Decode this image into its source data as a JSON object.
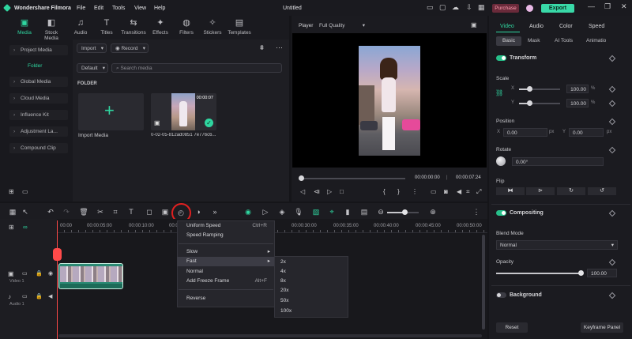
{
  "app": {
    "title": "Wondershare Filmora",
    "project_name": "Untitled"
  },
  "menu": [
    "File",
    "Edit",
    "Tools",
    "View",
    "Help"
  ],
  "header_buttons": {
    "purchase": "Purchase",
    "export": "Export"
  },
  "toolbar_tabs": [
    "Media",
    "Stock Media",
    "Audio",
    "Titles",
    "Transitions",
    "Effects",
    "Filters",
    "Stickers",
    "Templates"
  ],
  "sidebar": {
    "items": [
      "Project Media",
      "Folder",
      "Global Media",
      "Cloud Media",
      "Influence Kit",
      "Adjustment La...",
      "Compound Clip"
    ]
  },
  "media_toolbar": {
    "import_label": "Import",
    "record_label": "Record",
    "sort_label": "Default",
    "search_placeholder": "Search media"
  },
  "media": {
    "folder_label": "FOLDER",
    "import_tile_label": "Import Media",
    "clip_duration": "00:00:07",
    "clip_name": "0-02-05-812ad0851 7e776c6..."
  },
  "player": {
    "label": "Player",
    "quality": "Full Quality",
    "current_time": "00:00:00:00",
    "total_time": "00:00:07:24"
  },
  "timeline": {
    "ruler": [
      "00:00",
      "00:00:05:00",
      "00:00:10:00",
      "00:00",
      "00:00:30:00",
      "00:00:35:00",
      "00:00:40:00",
      "00:00:45:00",
      "00:00:50:00"
    ],
    "tracks": {
      "video": "Video 1",
      "audio": "Audio 1"
    }
  },
  "speed_menu": {
    "items": [
      {
        "label": "Uniform Speed",
        "shortcut": "Ctrl+R"
      },
      {
        "label": "Speed Ramping",
        "shortcut": ""
      },
      {
        "label": "Slow",
        "shortcut": ""
      },
      {
        "label": "Fast",
        "shortcut": ""
      },
      {
        "label": "Normal",
        "shortcut": ""
      },
      {
        "label": "Add Freeze Frame",
        "shortcut": "Alt+F"
      },
      {
        "label": "Reverse",
        "shortcut": ""
      }
    ],
    "fast_submenu": [
      "2x",
      "4x",
      "8x",
      "20x",
      "50x",
      "100x"
    ]
  },
  "properties": {
    "top_tabs": [
      "Video",
      "Audio",
      "Color",
      "Speed"
    ],
    "sub_tabs": [
      "Basic",
      "Mask",
      "AI Tools",
      "Animatio"
    ],
    "transform": "Transform",
    "scale": {
      "label": "Scale",
      "x_label": "X",
      "y_label": "Y",
      "x_value": "100.00",
      "y_value": "100.00",
      "unit": "%"
    },
    "position": {
      "label": "Position",
      "x_label": "X",
      "y_label": "Y",
      "x_value": "0.00",
      "y_value": "0.00",
      "unit": "px"
    },
    "rotate": {
      "label": "Rotate",
      "value": "0.00°"
    },
    "flip": "Flip",
    "compositing": "Compositing",
    "blend_mode": {
      "label": "Blend Mode",
      "value": "Normal"
    },
    "opacity": {
      "label": "Opacity",
      "value": "100.00"
    },
    "background": "Background",
    "reset_label": "Reset",
    "keyframe_label": "Keyframe Panel"
  },
  "colors": {
    "accent": "#2fd6a0",
    "export_bg": "#39d9a8",
    "purchase_bg": "#6a2a3a",
    "highlight_ring": "#e02020",
    "playhead": "#ff4a4a"
  }
}
